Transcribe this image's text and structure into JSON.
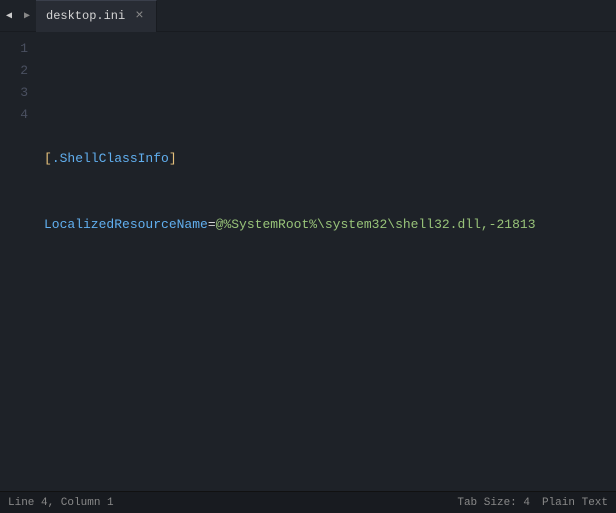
{
  "tab": {
    "filename": "desktop.ini",
    "close_label": "×"
  },
  "nav": {
    "left_arrow": "◀",
    "right_arrow": "▶"
  },
  "editor": {
    "lines": [
      {
        "number": 1,
        "content": "",
        "parts": []
      },
      {
        "number": 2,
        "content": "[.ShellClassInfo]",
        "type": "section"
      },
      {
        "number": 3,
        "content": "LocalizedResourceName=@%SystemRoot%\\system32\\shell32.dll,-21813",
        "type": "keyvalue"
      },
      {
        "number": 4,
        "content": "",
        "parts": []
      }
    ]
  },
  "statusbar": {
    "position": "Line 4, Column 1",
    "tab_size": "Tab Size: 4",
    "syntax": "Plain Text"
  }
}
